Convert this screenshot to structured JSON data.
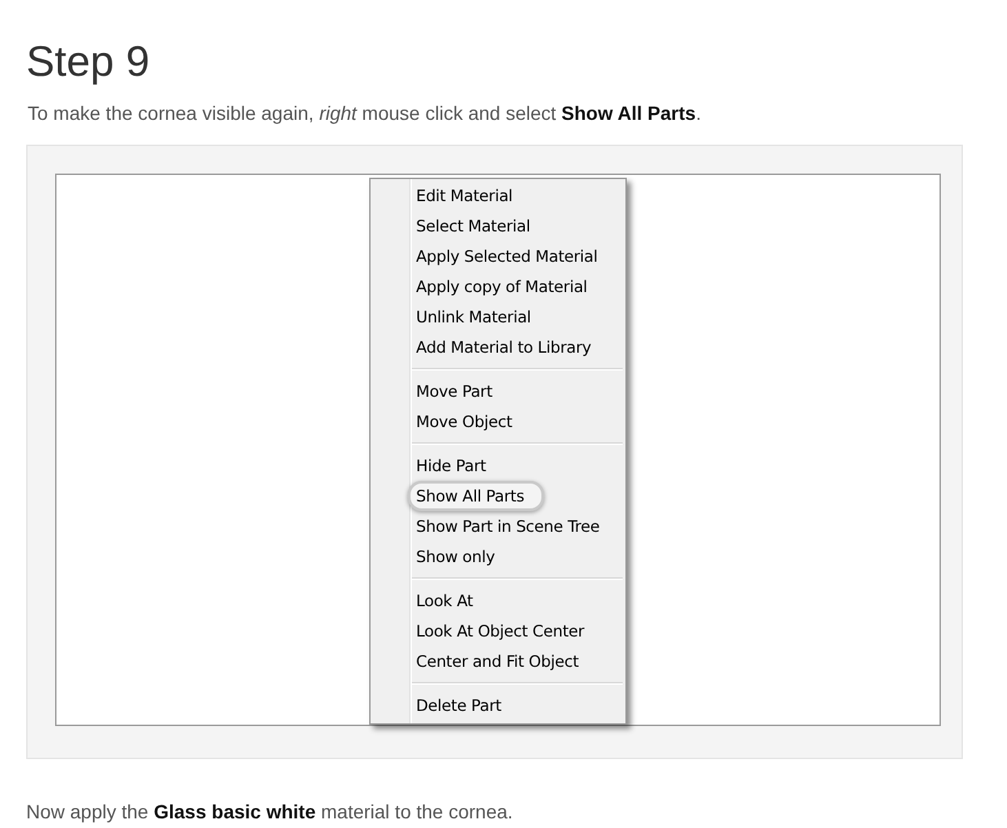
{
  "title": "Step 9",
  "intro": "To make the cornea visible again, *right* mouse click and select **Show All Parts**.",
  "context_menu": {
    "groups": [
      {
        "items": [
          {
            "label": "Edit Material",
            "highlighted": false
          },
          {
            "label": "Select Material",
            "highlighted": false
          },
          {
            "label": "Apply Selected Material",
            "highlighted": false
          },
          {
            "label": "Apply copy of Material",
            "highlighted": false
          },
          {
            "label": "Unlink Material",
            "highlighted": false
          },
          {
            "label": "Add Material to Library",
            "highlighted": false
          }
        ]
      },
      {
        "items": [
          {
            "label": "Move Part",
            "highlighted": false
          },
          {
            "label": "Move Object",
            "highlighted": false
          }
        ]
      },
      {
        "items": [
          {
            "label": "Hide Part",
            "highlighted": false
          },
          {
            "label": "Show All Parts",
            "highlighted": true
          },
          {
            "label": "Show Part in Scene Tree",
            "highlighted": false
          },
          {
            "label": "Show only",
            "highlighted": false
          }
        ]
      },
      {
        "items": [
          {
            "label": "Look At",
            "highlighted": false
          },
          {
            "label": "Look At Object Center",
            "highlighted": false
          },
          {
            "label": "Center and Fit Object",
            "highlighted": false
          }
        ]
      },
      {
        "items": [
          {
            "label": "Delete Part",
            "highlighted": false
          }
        ]
      }
    ]
  },
  "next_step": "Now apply the **Glass basic white** material to the cornea."
}
